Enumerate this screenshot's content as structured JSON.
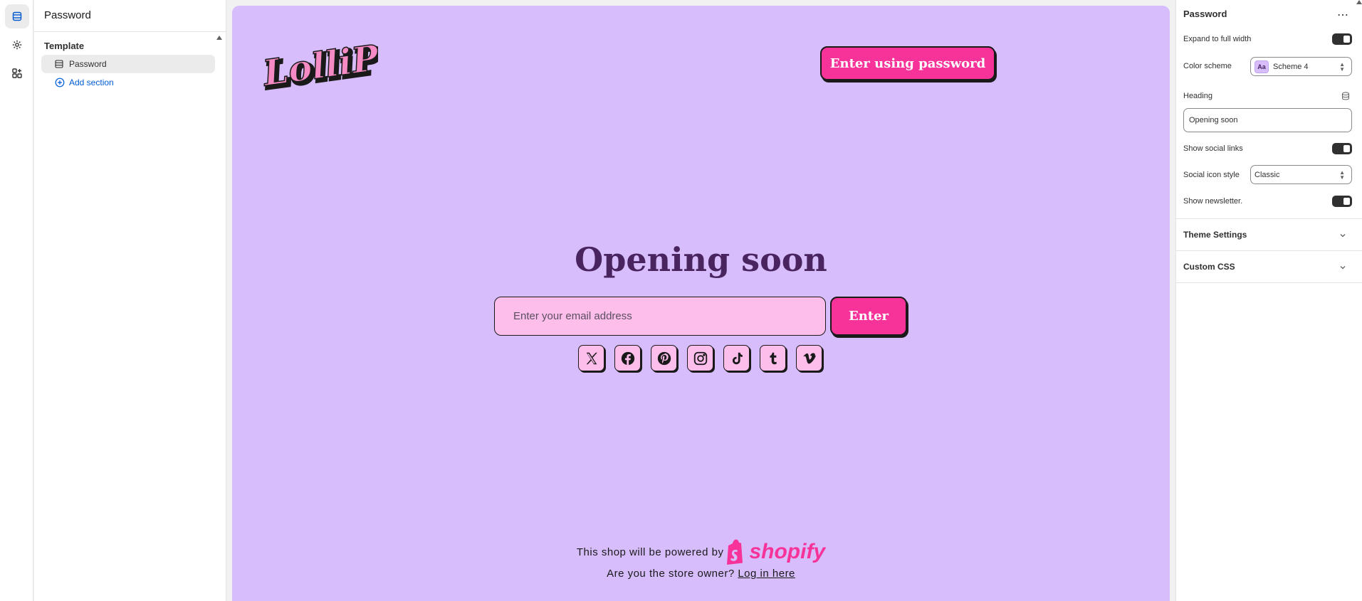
{
  "rail": {
    "items": [
      {
        "icon": "sections-icon",
        "active": true
      },
      {
        "icon": "settings-gear-icon",
        "active": false
      },
      {
        "icon": "apps-icon",
        "active": false
      }
    ]
  },
  "sidebar": {
    "title": "Password",
    "group_label": "Template",
    "items": [
      {
        "label": "Password",
        "icon": "section-icon"
      }
    ],
    "add_section_label": "Add section"
  },
  "preview": {
    "logo_text": "LolliPop",
    "enter_password_label": "Enter using password",
    "heading": "Opening soon",
    "email_placeholder": "Enter your email address",
    "enter_label": "Enter",
    "social_icons": [
      "x-icon",
      "facebook-icon",
      "pinterest-icon",
      "instagram-icon",
      "tiktok-icon",
      "tumblr-icon",
      "vimeo-icon"
    ],
    "powered_by": "This shop will be powered by",
    "shopify_word": "shopify",
    "owner_question": "Are you the store owner?",
    "login_link": "Log in here",
    "colors": {
      "background": "#d7bdfc",
      "accent": "#f7339a",
      "heading": "#49245f",
      "input": "#fdbeec"
    }
  },
  "panel": {
    "title": "Password",
    "more_label": "⋯",
    "expand_label": "Expand to full width",
    "expand_on": true,
    "color_scheme_label": "Color scheme",
    "color_scheme_swatch": "Aa",
    "color_scheme_value": "Scheme 4",
    "heading_label": "Heading",
    "heading_value": "Opening soon",
    "social_links_label": "Show social links",
    "social_links_on": true,
    "social_icon_style_label": "Social icon style",
    "social_icon_style_value": "Classic",
    "newsletter_label": "Show newsletter.",
    "newsletter_on": true,
    "theme_settings_label": "Theme Settings",
    "custom_css_label": "Custom CSS"
  }
}
